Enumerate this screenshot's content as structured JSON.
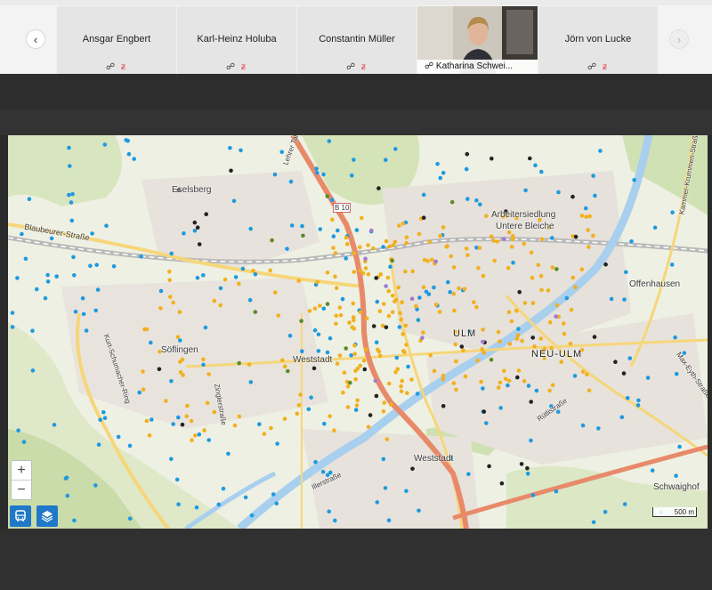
{
  "participants": [
    {
      "name": "Ansgar Engbert"
    },
    {
      "name": "Karl-Heinz Holuba"
    },
    {
      "name": "Constantin Müller"
    },
    {
      "name": "Katharina Schwei..."
    },
    {
      "name": "Jörn von Lucke"
    }
  ],
  "nav": {
    "prev_icon": "chevron-left-icon",
    "next_icon": "chevron-right-icon"
  },
  "map": {
    "labels": {
      "eselsberg": "Eselsberg",
      "blaubeurer": "Blaubeurer-Straße",
      "arbeitersiedlung": "Arbeitersiedlung",
      "untere_bleiche": "Untere Bleiche",
      "offenhausen": "Offenhausen",
      "soeflingen": "Söflingen",
      "weststadt": "Weststadt",
      "ulm": "ULM",
      "neu_ulm": "NEU-ULM",
      "weststadt2": "Weststadt",
      "schwaighof": "Schwaighof",
      "b10": "B 10",
      "kurt_schumacher": "Kurt-Schumacher-Ring",
      "illerstrasse": "Illerstraße",
      "zinglerstrasse": "Zinglerstraße",
      "max_eyth": "Max-Eyth-Straße",
      "kammer_krummen": "Kammer-Krummen-Straße",
      "lehrer_tal": "Lehrer Tal",
      "ruetlistrasse": "Rütlistraße"
    },
    "scale": "500 m"
  },
  "colors": {
    "marker_blue": "#1e9ae0",
    "marker_orange": "#f2b01e",
    "marker_black": "#222222",
    "marker_green": "#5d8a2a",
    "marker_purple": "#a07ad0"
  }
}
